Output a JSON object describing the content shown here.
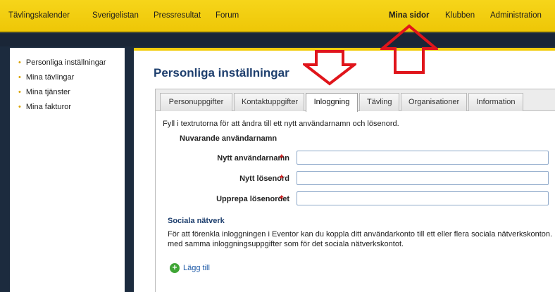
{
  "topnav": {
    "items": [
      "Tävlingskalender",
      "Sverigelistan",
      "Pressresultat",
      "Forum",
      "Mina sidor",
      "Klubben",
      "Administration"
    ],
    "active": "Mina sidor"
  },
  "sidebar": {
    "items": [
      {
        "label": "Personliga inställningar"
      },
      {
        "label": "Mina tävlingar"
      },
      {
        "label": "Mina tjänster"
      },
      {
        "label": "Mina fakturor"
      }
    ]
  },
  "main": {
    "title": "Personliga inställningar",
    "tabs": [
      "Personuppgifter",
      "Kontaktuppgifter",
      "Inloggning",
      "Tävling",
      "Organisationer",
      "Information"
    ],
    "active_tab": "Inloggning",
    "intro": "Fyll i textrutorna för att ändra till ett nytt användarnamn och lösenord.",
    "current_username_label": "Nuvarande användarnamn",
    "fields": [
      {
        "label": "Nytt användarnamn",
        "value": ""
      },
      {
        "label": "Nytt lösenord",
        "value": ""
      },
      {
        "label": "Upprepa lösenordet",
        "value": ""
      }
    ],
    "required_mark": "*",
    "social": {
      "heading": "Sociala nätverk",
      "description_line1": "För att förenkla inloggningen i Eventor kan du koppla ditt användarkonto till ett eller flera sociala nätverkskonton. Du",
      "description_line2": "med samma inloggningsuppgifter som för det sociala nätverkskontot.",
      "add_label": "Lägg till",
      "add_icon": "plus-circle-icon"
    }
  },
  "colors": {
    "topbar": "#f2cc0c",
    "background": "#1c2b3e",
    "title": "#1e3f6e",
    "required": "#d21d1d",
    "annotation_arrow": "#e0151b"
  }
}
